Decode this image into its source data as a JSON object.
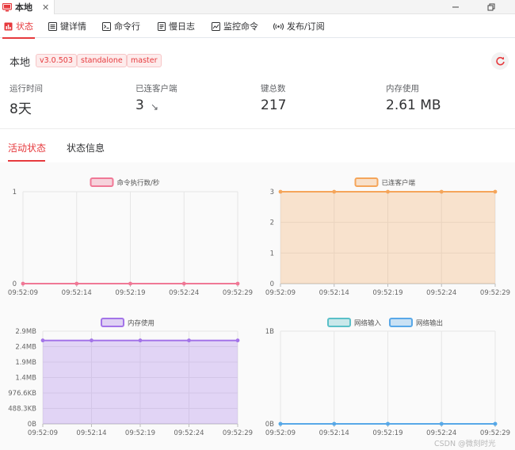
{
  "window": {
    "tab_title": "本地",
    "close_glyph": "✕",
    "icon": "monitor-icon"
  },
  "top_tabs": [
    {
      "label": "状态",
      "icon": "chart-icon",
      "active": true
    },
    {
      "label": "键详情",
      "icon": "keyboard-icon",
      "active": false
    },
    {
      "label": "命令行",
      "icon": "terminal-icon",
      "active": false
    },
    {
      "label": "慢日志",
      "icon": "document-icon",
      "active": false
    },
    {
      "label": "监控命令",
      "icon": "monitor-chart-icon",
      "active": false
    },
    {
      "label": "发布/订阅",
      "icon": "broadcast-icon",
      "active": false
    }
  ],
  "server": {
    "name": "本地",
    "tags": [
      "v3.0.503",
      "standalone",
      "master"
    ]
  },
  "stats": [
    {
      "label": "运行时间",
      "value": "8天"
    },
    {
      "label": "已连客户端",
      "value": "3",
      "trend": "↘"
    },
    {
      "label": "键总数",
      "value": "217"
    },
    {
      "label": "内存使用",
      "value": "2.61 MB"
    }
  ],
  "sub_tabs": [
    {
      "label": "活动状态",
      "active": true
    },
    {
      "label": "状态信息",
      "active": false
    }
  ],
  "colors": {
    "accent": "#e6393d",
    "cmd": "#f07896",
    "clients": "#f5a55a",
    "memory": "#a374e8",
    "net_in": "#5ac0c8",
    "net_out": "#58a8e8"
  },
  "chart_data": [
    {
      "type": "line",
      "x": [
        "09:52:09",
        "09:52:14",
        "09:52:19",
        "09:52:24",
        "09:52:29"
      ],
      "ylim": [
        0,
        1
      ],
      "yticks": [
        "0",
        "1"
      ],
      "series": [
        {
          "name": "命令执行数/秒",
          "values": [
            0,
            0,
            0,
            0,
            0
          ]
        }
      ]
    },
    {
      "type": "area",
      "x": [
        "09:52:09",
        "09:52:14",
        "09:52:19",
        "09:52:24",
        "09:52:29"
      ],
      "ylim": [
        0,
        3
      ],
      "yticks": [
        "0",
        "1",
        "2",
        "3"
      ],
      "series": [
        {
          "name": "已连客户端",
          "values": [
            3,
            3,
            3,
            3,
            3
          ]
        }
      ]
    },
    {
      "type": "area",
      "x": [
        "09:52:09",
        "09:52:14",
        "09:52:19",
        "09:52:24",
        "09:52:29"
      ],
      "ylim": [
        0,
        2.9
      ],
      "yticks": [
        "0B",
        "488.3KB",
        "976.6KB",
        "1.4MB",
        "1.9MB",
        "2.4MB",
        "2.9MB"
      ],
      "series": [
        {
          "name": "内存使用",
          "values": [
            2.61,
            2.61,
            2.61,
            2.61,
            2.61
          ]
        }
      ]
    },
    {
      "type": "line",
      "x": [
        "09:52:09",
        "09:52:14",
        "09:52:19",
        "09:52:24",
        "09:52:29"
      ],
      "ylim": [
        0,
        1
      ],
      "yticks": [
        "0B",
        "1B"
      ],
      "series": [
        {
          "name": "网络输入",
          "values": [
            0,
            0,
            0,
            0,
            0
          ]
        },
        {
          "name": "网络输出",
          "values": [
            0,
            0,
            0,
            0,
            0
          ]
        }
      ]
    }
  ],
  "watermark": "CSDN @微刻时光"
}
